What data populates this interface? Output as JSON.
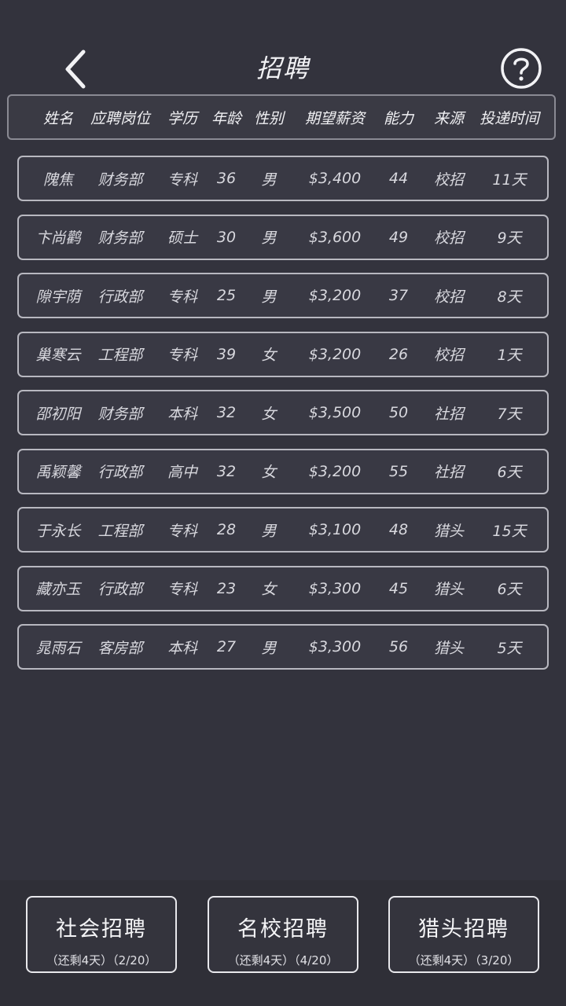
{
  "header": {
    "title": "招聘"
  },
  "columns": [
    "姓名",
    "应聘岗位",
    "学历",
    "年龄",
    "性别",
    "期望薪资",
    "能力",
    "来源",
    "投递时间"
  ],
  "candidates": [
    [
      "隗焦",
      "财务部",
      "专科",
      "36",
      "男",
      "$3,400",
      "44",
      "校招",
      "11天"
    ],
    [
      "卞尚鹳",
      "财务部",
      "硕士",
      "30",
      "男",
      "$3,600",
      "49",
      "校招",
      "9天"
    ],
    [
      "隙宇荫",
      "行政部",
      "专科",
      "25",
      "男",
      "$3,200",
      "37",
      "校招",
      "8天"
    ],
    [
      "巢寒云",
      "工程部",
      "专科",
      "39",
      "女",
      "$3,200",
      "26",
      "校招",
      "1天"
    ],
    [
      "邵初阳",
      "财务部",
      "本科",
      "32",
      "女",
      "$3,500",
      "50",
      "社招",
      "7天"
    ],
    [
      "禹颖馨",
      "行政部",
      "高中",
      "32",
      "女",
      "$3,200",
      "55",
      "社招",
      "6天"
    ],
    [
      "于永长",
      "工程部",
      "专科",
      "28",
      "男",
      "$3,100",
      "48",
      "猎头",
      "15天"
    ],
    [
      "藏亦玉",
      "行政部",
      "专科",
      "23",
      "女",
      "$3,300",
      "45",
      "猎头",
      "6天"
    ],
    [
      "晁雨石",
      "客房部",
      "本科",
      "27",
      "男",
      "$3,300",
      "56",
      "猎头",
      "5天"
    ]
  ],
  "buttons": [
    {
      "label": "社会招聘",
      "remaining": "（还剩4天）",
      "count": "（2/20）"
    },
    {
      "label": "名校招聘",
      "remaining": "（还剩4天）",
      "count": "（4/20）"
    },
    {
      "label": "猎头招聘",
      "remaining": "（还剩4天）",
      "count": "（3/20）"
    }
  ],
  "icons": {
    "back": "chevron-left-icon",
    "help": "question-circle-icon"
  },
  "colors": {
    "background": "#33333d",
    "border": "#b8b8c0",
    "text": "#e6e6ea"
  }
}
